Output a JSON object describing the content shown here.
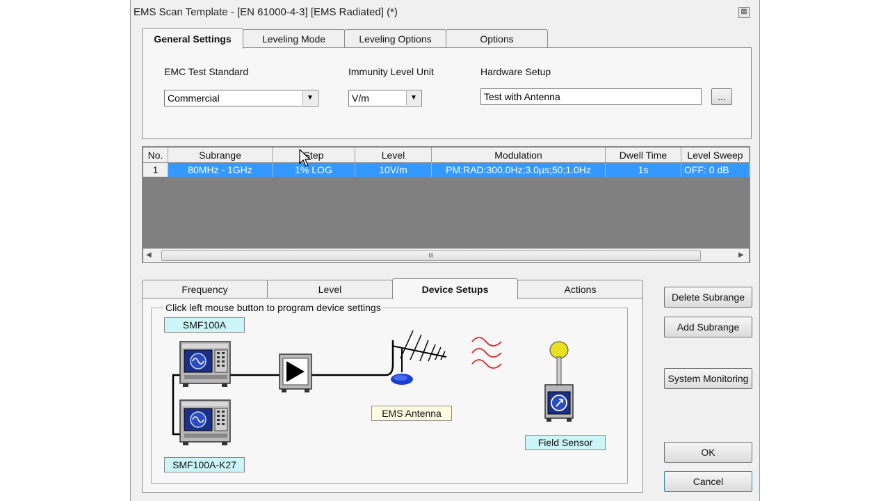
{
  "window": {
    "title": "EMS Scan Template - [EN 61000-4-3] [EMS Radiated] (*)",
    "close_glyph": "⊠"
  },
  "top_tabs": [
    {
      "label": "General Settings",
      "active": true
    },
    {
      "label": "Leveling Mode",
      "active": false
    },
    {
      "label": "Leveling Options",
      "active": false
    },
    {
      "label": "Options",
      "active": false
    }
  ],
  "general": {
    "emc_label": "EMC Test Standard",
    "emc_value": "Commercial",
    "unit_label": "Immunity Level Unit",
    "unit_value": "V/m",
    "hw_label": "Hardware Setup",
    "hw_value": "Test with Antenna",
    "browse_label": "..."
  },
  "grid": {
    "columns": [
      "No.",
      "Subrange",
      "Step",
      "Level",
      "Modulation",
      "Dwell Time",
      "Level Sweep"
    ],
    "rows": [
      [
        "1",
        "80MHz - 1GHz",
        "1% LOG",
        "10V/m",
        "PM:RAD:300.0Hz;3.0µs;50;1.0Hz",
        "1s",
        "OFF: 0 dB"
      ]
    ],
    "scroll_thumb": "III"
  },
  "bottom_tabs": [
    {
      "label": "Frequency",
      "active": false
    },
    {
      "label": "Level",
      "active": false
    },
    {
      "label": "Device Setups",
      "active": true
    },
    {
      "label": "Actions",
      "active": false
    }
  ],
  "device": {
    "group_caption": "Click left mouse button to program device settings",
    "generator1": "SMF100A",
    "generator2": "SMF100A-K27",
    "antenna": "EMS Antenna",
    "sensor": "Field Sensor"
  },
  "side_buttons": {
    "delete": "Delete Subrange",
    "add": "Add Subrange",
    "monitor": "System Monitoring",
    "ok": "OK",
    "cancel": "Cancel"
  },
  "colors": {
    "selection": "#3399ff",
    "grid_bg": "#808080",
    "cyan_label": "#ccf5f7",
    "yellow_label": "#fffbe0",
    "wave_red": "#e02020",
    "device_blue": "#1a2f8a"
  }
}
